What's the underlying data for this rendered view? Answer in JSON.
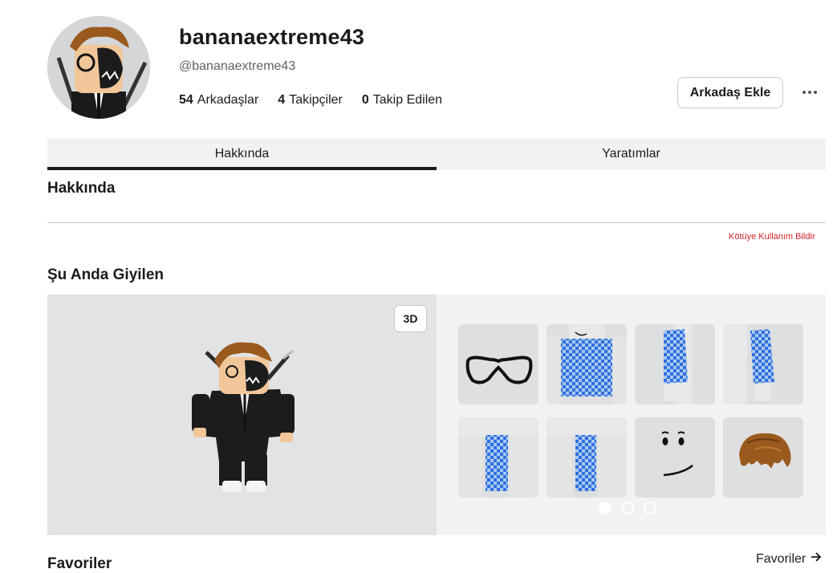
{
  "profile": {
    "display_name": "bananaextreme43",
    "username": "@bananaextreme43",
    "stats": [
      {
        "count": "54",
        "label": "Arkadaşlar"
      },
      {
        "count": "4",
        "label": "Takipçiler"
      },
      {
        "count": "0",
        "label": "Takip Edilen"
      }
    ],
    "add_friend_label": "Arkadaş Ekle",
    "more_icon": "ellipsis-icon"
  },
  "tabs": [
    {
      "label": "Hakkında",
      "active": true
    },
    {
      "label": "Yaratımlar",
      "active": false
    }
  ],
  "about": {
    "title": "Hakkında",
    "report_label": "Kötüye Kullanım Bildir"
  },
  "wearing": {
    "title": "Şu Anda Giyilen",
    "view_toggle_label": "3D",
    "items": [
      {
        "icon": "glasses-icon"
      },
      {
        "icon": "checkered-shirt-icon"
      },
      {
        "icon": "checkered-right-sleeve-icon"
      },
      {
        "icon": "checkered-left-sleeve-icon"
      },
      {
        "icon": "checkered-right-leg-icon"
      },
      {
        "icon": "checkered-left-leg-icon"
      },
      {
        "icon": "smile-face-icon"
      },
      {
        "icon": "brown-hair-icon"
      }
    ],
    "page_count": 3,
    "current_page": 1
  },
  "favorites": {
    "title": "Favoriler",
    "link_label": "Favoriler"
  },
  "colors": {
    "report": "#d2232a",
    "checker_blue": "#2f6fe0",
    "hair_brown": "#9a5a1e",
    "tab_background": "#f2f2f2"
  }
}
